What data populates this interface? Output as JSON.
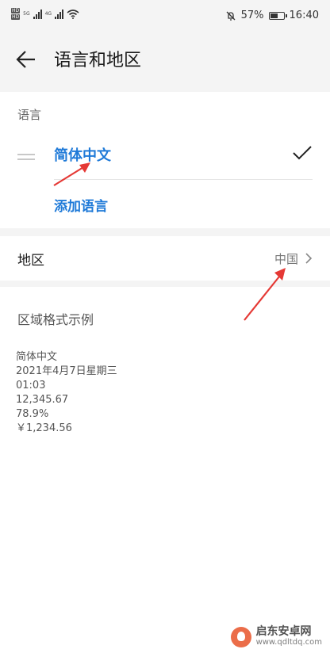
{
  "status_bar": {
    "sim1": "HD",
    "sim2": "HD",
    "net1": "5G",
    "net2": "4G",
    "battery_percent": "57%",
    "battery_level": 0.57,
    "time": "16:40"
  },
  "header": {
    "title": "语言和地区"
  },
  "language_section": {
    "label": "语言",
    "items": [
      {
        "label": "简体中文",
        "selected": true
      }
    ],
    "add_label": "添加语言"
  },
  "region": {
    "label": "地区",
    "value": "中国"
  },
  "format_example": {
    "title": "区域格式示例",
    "lines": [
      "简体中文",
      "2021年4月7日星期三",
      "01:03",
      "12,345.67",
      "78.9%",
      "￥1,234.56"
    ]
  },
  "watermark": {
    "name": "启东安卓网",
    "url": "www.qdltdq.com"
  },
  "colors": {
    "accent": "#1f7ad8",
    "annotation_arrow": "#e53935"
  }
}
